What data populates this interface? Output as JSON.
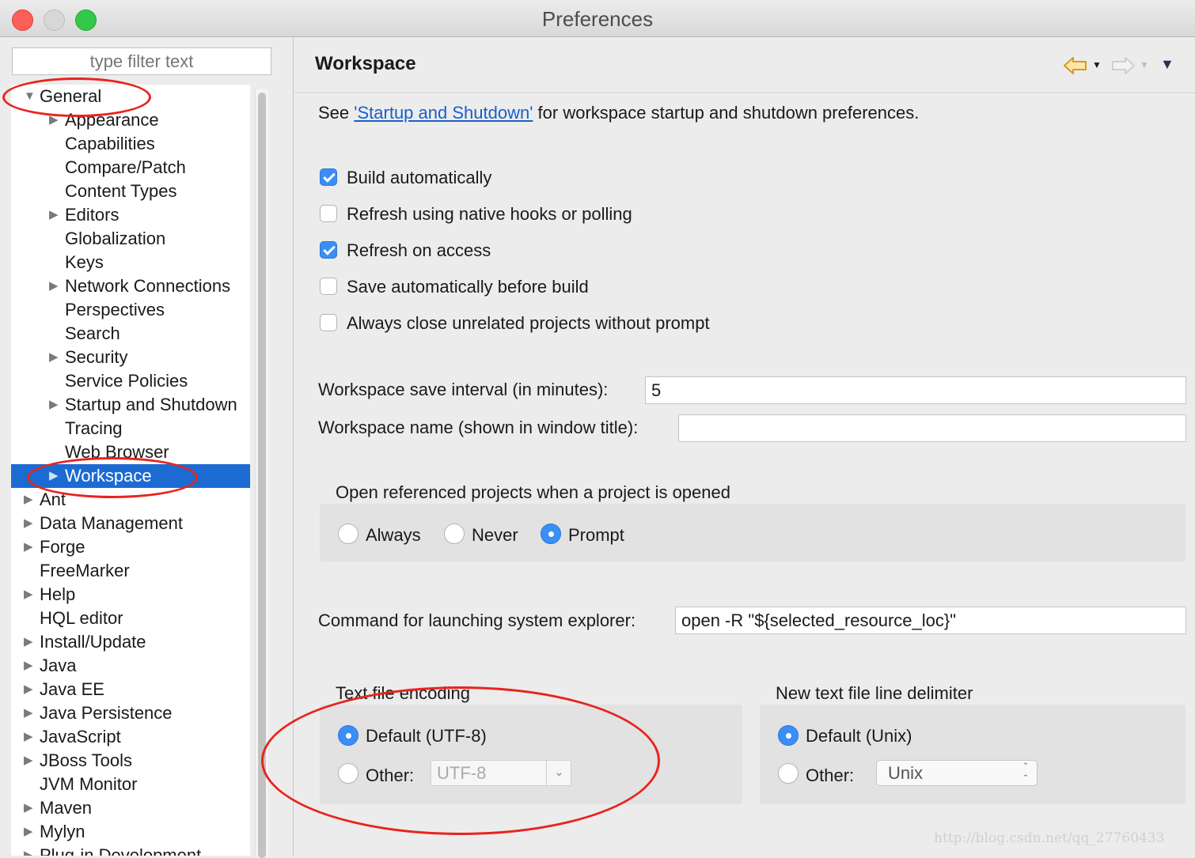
{
  "window": {
    "title": "Preferences"
  },
  "sidebar": {
    "filter_placeholder": "type filter text",
    "tree": [
      {
        "label": "General",
        "expanded": true,
        "level": 0,
        "has_children": true
      },
      {
        "label": "Appearance",
        "level": 1,
        "has_children": true
      },
      {
        "label": "Capabilities",
        "level": 1,
        "has_children": false
      },
      {
        "label": "Compare/Patch",
        "level": 1,
        "has_children": false
      },
      {
        "label": "Content Types",
        "level": 1,
        "has_children": false
      },
      {
        "label": "Editors",
        "level": 1,
        "has_children": true
      },
      {
        "label": "Globalization",
        "level": 1,
        "has_children": false
      },
      {
        "label": "Keys",
        "level": 1,
        "has_children": false
      },
      {
        "label": "Network Connections",
        "level": 1,
        "has_children": true
      },
      {
        "label": "Perspectives",
        "level": 1,
        "has_children": false
      },
      {
        "label": "Search",
        "level": 1,
        "has_children": false
      },
      {
        "label": "Security",
        "level": 1,
        "has_children": true
      },
      {
        "label": "Service Policies",
        "level": 1,
        "has_children": false
      },
      {
        "label": "Startup and Shutdown",
        "level": 1,
        "has_children": true
      },
      {
        "label": "Tracing",
        "level": 1,
        "has_children": false
      },
      {
        "label": "Web Browser",
        "level": 1,
        "has_children": false
      },
      {
        "label": "Workspace",
        "level": 1,
        "has_children": true,
        "selected": true
      },
      {
        "label": "Ant",
        "level": 0,
        "has_children": true
      },
      {
        "label": "Data Management",
        "level": 0,
        "has_children": true
      },
      {
        "label": "Forge",
        "level": 0,
        "has_children": true
      },
      {
        "label": "FreeMarker",
        "level": 0,
        "has_children": false
      },
      {
        "label": "Help",
        "level": 0,
        "has_children": true
      },
      {
        "label": "HQL editor",
        "level": 0,
        "has_children": false
      },
      {
        "label": "Install/Update",
        "level": 0,
        "has_children": true
      },
      {
        "label": "Java",
        "level": 0,
        "has_children": true
      },
      {
        "label": "Java EE",
        "level": 0,
        "has_children": true
      },
      {
        "label": "Java Persistence",
        "level": 0,
        "has_children": true
      },
      {
        "label": "JavaScript",
        "level": 0,
        "has_children": true
      },
      {
        "label": "JBoss Tools",
        "level": 0,
        "has_children": true
      },
      {
        "label": "JVM Monitor",
        "level": 0,
        "has_children": false
      },
      {
        "label": "Maven",
        "level": 0,
        "has_children": true
      },
      {
        "label": "Mylyn",
        "level": 0,
        "has_children": true
      },
      {
        "label": "Plug-in Development",
        "level": 0,
        "has_children": true
      }
    ]
  },
  "page": {
    "title": "Workspace",
    "intro_prefix": "See",
    "intro_link": "'Startup and Shutdown'",
    "intro_suffix": "for workspace startup and shutdown preferences.",
    "checkboxes": [
      {
        "label": "Build automatically",
        "checked": true
      },
      {
        "label": "Refresh using native hooks or polling",
        "checked": false
      },
      {
        "label": "Refresh on access",
        "checked": true
      },
      {
        "label": "Save automatically before build",
        "checked": false
      },
      {
        "label": "Always close unrelated projects without prompt",
        "checked": false
      }
    ],
    "save_interval_label": "Workspace save interval (in minutes):",
    "save_interval_value": "5",
    "workspace_name_label": "Workspace name (shown in window title):",
    "workspace_name_value": "",
    "open_ref": {
      "title": "Open referenced projects when a project is opened",
      "options": [
        "Always",
        "Never",
        "Prompt"
      ],
      "selected": "Prompt"
    },
    "explorer_label": "Command for launching system explorer:",
    "explorer_value": "open -R \"${selected_resource_loc}\"",
    "encoding": {
      "title": "Text file encoding",
      "default_label": "Default (UTF-8)",
      "other_label": "Other:",
      "other_value": "UTF-8",
      "selected": "default"
    },
    "delimiter": {
      "title": "New text file line delimiter",
      "default_label": "Default (Unix)",
      "other_label": "Other:",
      "other_value": "Unix",
      "selected": "default"
    }
  },
  "nav_icons": [
    "back-arrow-icon",
    "forward-arrow-icon",
    "view-menu-icon"
  ],
  "colors": {
    "selection": "#1c6bd3",
    "checkbox_on": "#3b8ef5",
    "annotation": "#e8241c",
    "link": "#1a5fc9"
  },
  "watermark": "http://blog.csdn.net/qq_27760433"
}
